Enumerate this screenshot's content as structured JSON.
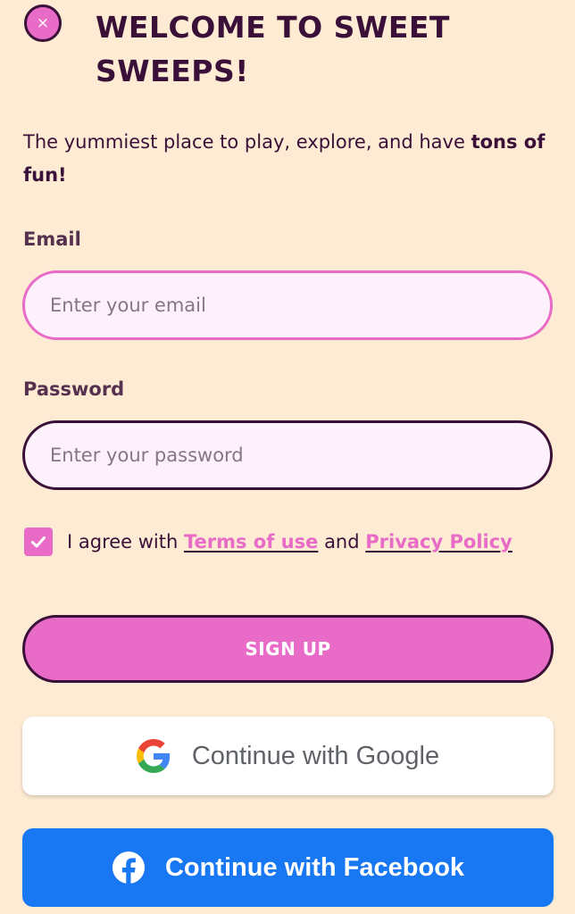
{
  "header": {
    "close_symbol": "×",
    "title": "WELCOME TO SWEET SWEEPS!"
  },
  "intro": {
    "text": "The yummiest place to play, explore, and have ",
    "highlight": "tons of fun!"
  },
  "form": {
    "email_label": "Email",
    "email_placeholder": "Enter your email",
    "password_label": "Password",
    "password_placeholder": "Enter your password",
    "agree": {
      "checked": true,
      "prefix": "I agree with ",
      "terms_link": "Terms of use",
      "joiner": " and ",
      "privacy_link": "Privacy Policy"
    },
    "signup_label": "SIGN UP"
  },
  "social": {
    "google_label": "Continue with Google",
    "facebook_label": "Continue with Facebook"
  },
  "colors": {
    "background": "#fdebd3",
    "accent_pink": "#e96bc8",
    "dark_purple": "#3a1038",
    "facebook_blue": "#1877f2"
  },
  "icons": {
    "close": "close-icon",
    "check": "checkmark-icon",
    "google": "google-logo-icon",
    "facebook": "facebook-logo-icon"
  }
}
